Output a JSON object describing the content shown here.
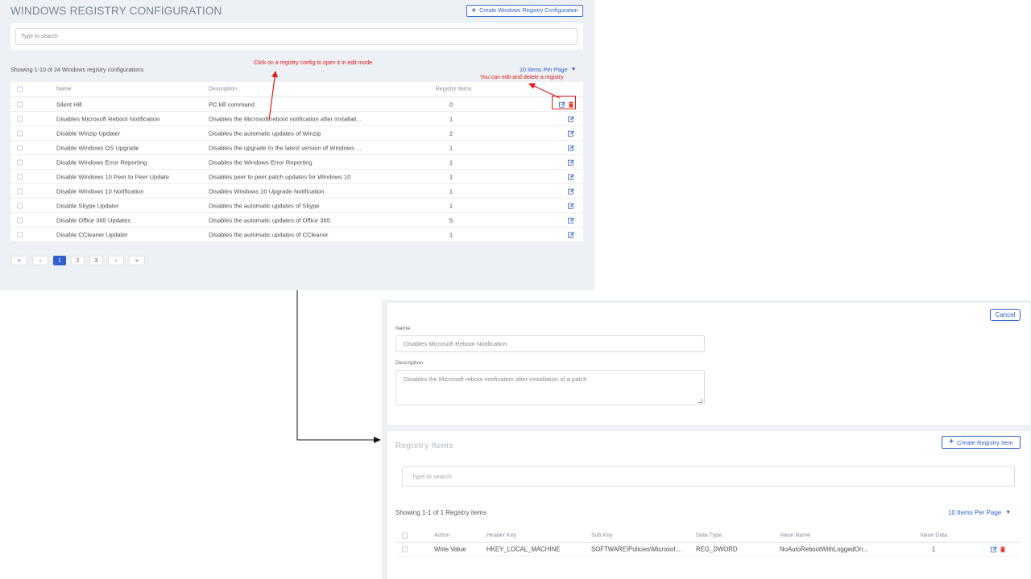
{
  "top": {
    "title": "WINDOWS REGISTRY CONFIGURATION",
    "create_button": "Create Windows Registry Configuration",
    "search_placeholder": "Type to search",
    "showing": "Showing 1-10 of 24 Windows registry configurations",
    "per_page": "10 Items Per Page",
    "columns": {
      "name": "Name",
      "description": "Description",
      "items": "Registry Items"
    },
    "rows": [
      {
        "name": "Silent Hill",
        "description": "PC kill command",
        "items": "0"
      },
      {
        "name": "Disables Microsoft Reboot Notification",
        "description": "Disables the Microsoft reboot notification after installati...",
        "items": "1"
      },
      {
        "name": "Disable Winzip Updater",
        "description": "Disables the automatic updates of Winzip",
        "items": "2"
      },
      {
        "name": "Disable Windows OS Upgrade",
        "description": "Disables the upgrade to the latest version of Windows ...",
        "items": "1"
      },
      {
        "name": "Disable Windows Error Reporting",
        "description": "Disables the Windows Error Reporting",
        "items": "1"
      },
      {
        "name": "Disable Windows 10 Peer to Peer Update",
        "description": "Disables peer to peer patch updates for Windows 10",
        "items": "1"
      },
      {
        "name": "Disable Windows 10 Notification",
        "description": "Disables Windows 10 Upgrade Notification",
        "items": "1"
      },
      {
        "name": "Disable Skype Updater",
        "description": "Disables the automatic updates of Skype",
        "items": "1"
      },
      {
        "name": "Disable Office 365 Updates",
        "description": "Disables the automatic updates of Office 365",
        "items": "5"
      },
      {
        "name": "Disable CCleaner Updater",
        "description": "Disables the automatic updates of CCleaner",
        "items": "1"
      }
    ],
    "pagination": {
      "first": "«",
      "prev": "‹",
      "pages": [
        "1",
        "2",
        "3"
      ],
      "next": "›",
      "last": "»",
      "current": "1"
    }
  },
  "annotations": {
    "click_hint": "Click on a registry config to open it in edit mode",
    "edit_hint": "You can edit and detele a registry"
  },
  "edit": {
    "cancel": "Cancel",
    "name_label": "Name",
    "name_value": "Disables Microsoft Reboot Notification",
    "description_label": "Description",
    "description_value": "Disables the Microsoft reboot notification after installation of a patch",
    "items_title": "Registry Items",
    "create_item": "Create Registry Item",
    "search_placeholder": "Type to search",
    "showing": "Showing 1-1 of 1 Registry items",
    "per_page": "10 Items Per Page",
    "columns": {
      "action": "Action",
      "header_key": "Header Key",
      "sub_key": "Sub Key",
      "data_type": "Data Type",
      "value_name": "Value Name",
      "value_data": "Value Data"
    },
    "rows": [
      {
        "action": "Write Value",
        "header_key": "HKEY_LOCAL_MACHINE",
        "sub_key": "SOFTWARE\\Policies\\Microsof...",
        "data_type": "REG_DWORD",
        "value_name": "NoAutoRebootWithLoggedOn...",
        "value_data": "1"
      }
    ]
  },
  "colors": {
    "accent": "#2f62c9",
    "danger": "#e03b3b",
    "annotation": "#e01b1b",
    "panel_bg": "#edf0f4"
  },
  "icons": {
    "edit": "edit-icon",
    "delete": "trash-icon",
    "plus": "plus-icon",
    "caret": "caret-down-icon"
  }
}
